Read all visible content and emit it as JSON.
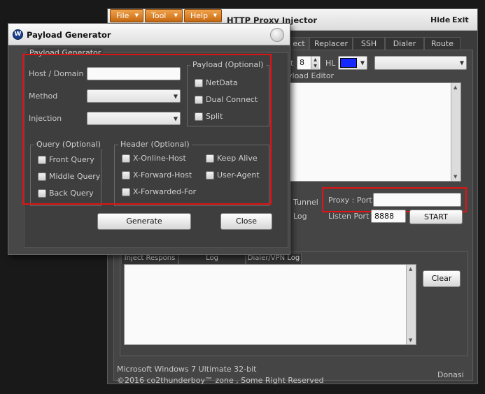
{
  "main_window": {
    "menus": [
      "File",
      "Tool",
      "Help"
    ],
    "title": "HTTP Proxy Injector",
    "hide_label": "Hide",
    "exit_label": "Exit",
    "tabs": [
      "ect",
      "Replacer",
      "SSH",
      "Dialer",
      "Route"
    ],
    "toolbar": {
      "t_label": "t",
      "spin_value": "8",
      "hl_label": "HL",
      "hl_color": "#1428ff"
    },
    "editor_label": "yload Editor",
    "tunnel_label": "Tunnel",
    "log_label": "Log",
    "proxy_port_label": "Proxy : Port",
    "proxy_port_value": "",
    "listen_port_label": "Listen Port",
    "listen_port_value": "8888",
    "start_label": "START",
    "bottom_tabs": [
      "Inject Respons",
      "Log",
      "Dialer/VPN Log"
    ],
    "clear_label": "Clear",
    "status_os": "Microsoft Windows 7 Ultimate  32-bit",
    "copyright": "©2016  co2thunderboy™ zone , Some Right Reserved",
    "donate": "Donasi"
  },
  "payload_generator": {
    "title": "Payload Generator",
    "group_title": "Payload Generator",
    "host_label": "Host / Domain",
    "host_value": "",
    "method_label": "Method",
    "method_value": "",
    "injection_label": "Injection",
    "injection_value": "",
    "payload_optional": {
      "title": "Payload (Optional)",
      "items": [
        "NetData",
        "Dual Connect",
        "Split"
      ]
    },
    "query_optional": {
      "title": "Query (Optional)",
      "items": [
        "Front Query",
        "Middle Query",
        "Back Query"
      ]
    },
    "header_optional": {
      "title": "Header (Optional)",
      "items": [
        "X-Online-Host",
        "X-Forward-Host",
        "X-Forwarded-For",
        "Keep Alive",
        "User-Agent"
      ]
    },
    "generate_label": "Generate",
    "close_label": "Close"
  },
  "colors": {
    "highlight_red": "#e01414",
    "menu_orange": "#d97a1e"
  }
}
